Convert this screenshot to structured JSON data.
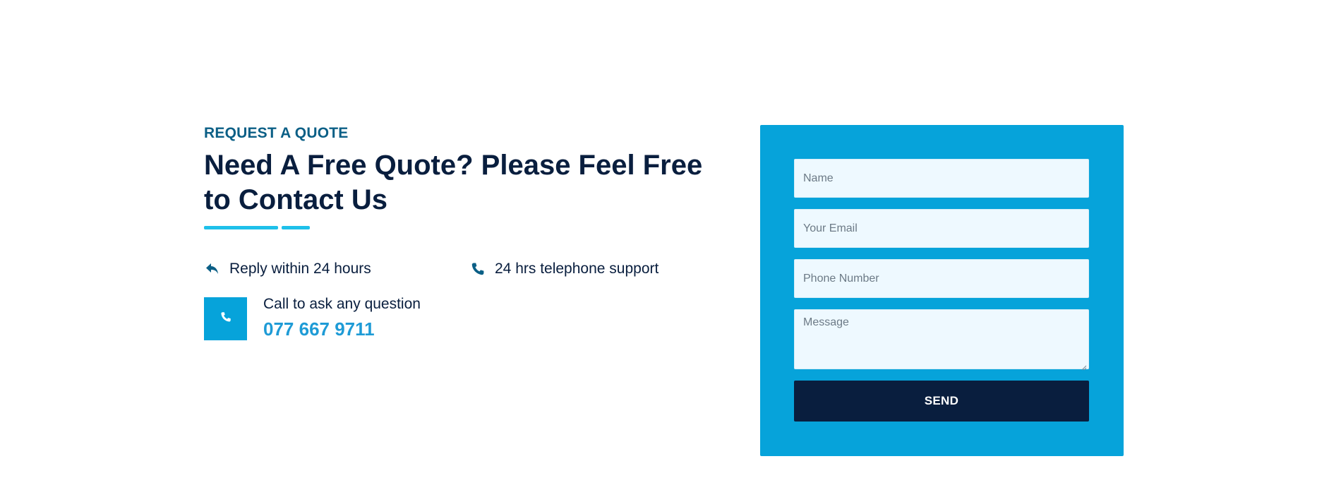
{
  "quote_section": {
    "eyebrow": "REQUEST A QUOTE",
    "heading": "Need A Free Quote? Please Feel Free to Contact Us",
    "features": [
      {
        "icon": "reply-icon",
        "label": "Reply within 24 hours"
      },
      {
        "icon": "phone-icon",
        "label": "24 hrs telephone support"
      }
    ],
    "call": {
      "icon": "phone-icon",
      "label": "Call to ask any question",
      "number": "077 667 9711"
    }
  },
  "form": {
    "name_placeholder": "Name",
    "email_placeholder": "Your Email",
    "phone_placeholder": "Phone Number",
    "message_placeholder": "Message",
    "send_label": "SEND"
  },
  "colors": {
    "accent": "#06A3DA",
    "dark": "#091E3E",
    "input_bg": "#EEF9FF",
    "eyebrow": "#0b5f86",
    "underline": "#1ec0ea"
  }
}
